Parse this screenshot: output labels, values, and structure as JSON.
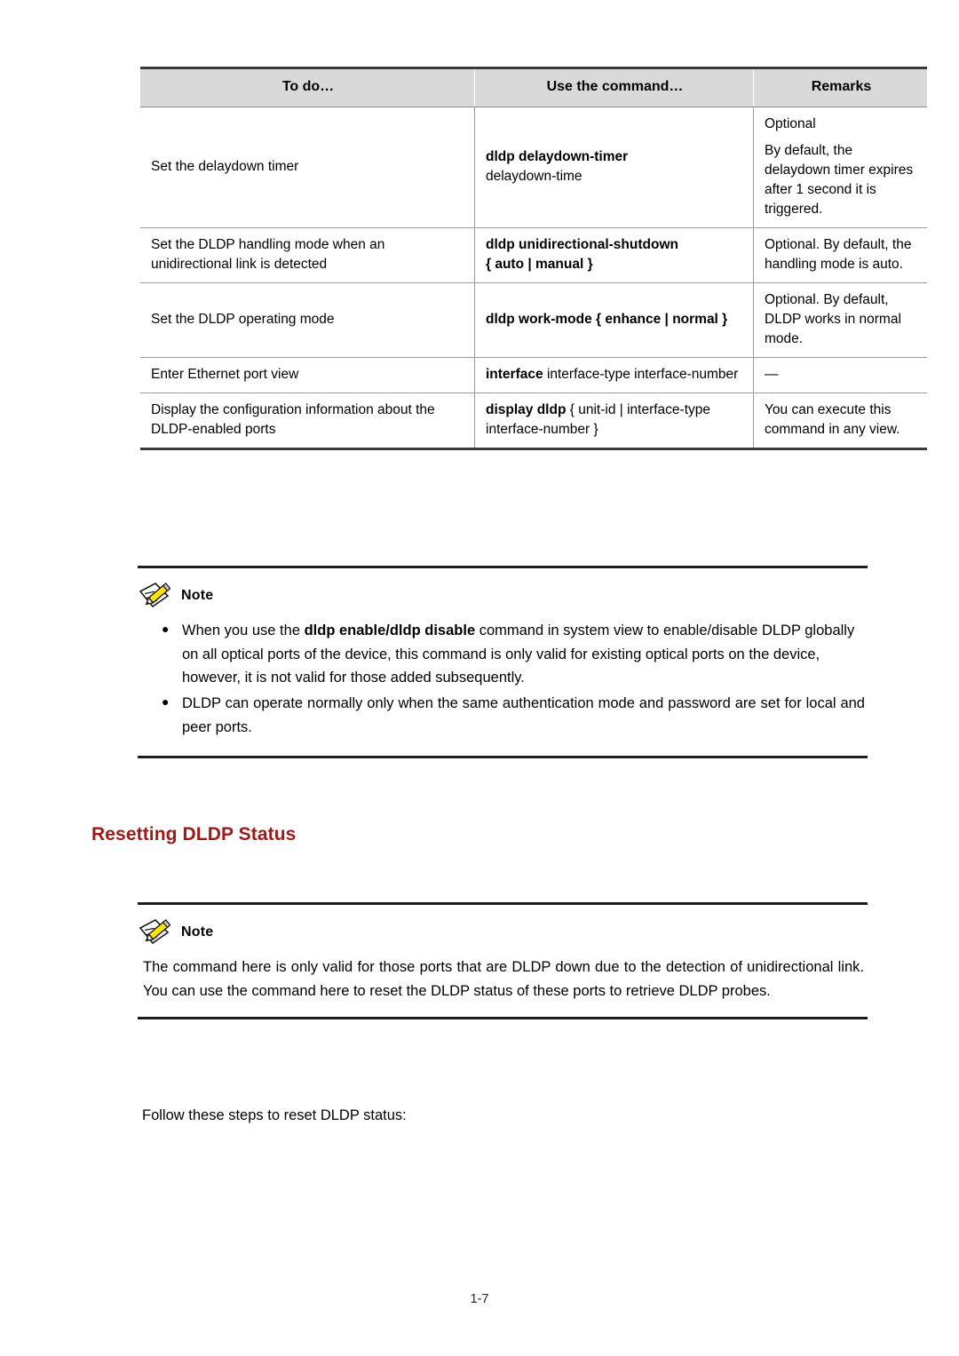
{
  "document": {
    "page_number": "1-7"
  },
  "table": {
    "headers": [
      "To do…",
      "Use the command…",
      "Remarks"
    ],
    "rows": [
      {
        "todo": "Set the delaydown timer",
        "command_bold": "dldp delaydown-timer",
        "command_plain": "delaydown-time",
        "remarks": [
          "Optional",
          "By default, the delaydown timer expires after 1 second it is triggered."
        ]
      },
      {
        "todo": "Set the DLDP handling mode when an unidirectional link is detected",
        "command_bold": "dldp unidirectional-shutdown",
        "command_plain": "{ auto | manual }",
        "remarks": [
          "Optional. By default, the handling mode is auto."
        ]
      },
      {
        "todo": "Set the DLDP operating mode",
        "command_bold": "dldp work-mode",
        "command_plain": "{ enhance | normal }",
        "remarks": [
          "Optional. By default, DLDP works in normal mode."
        ]
      },
      {
        "todo": "Enter Ethernet port view",
        "command_bold": "interface",
        "command_plain": "interface-type interface-number",
        "remarks": [
          "—"
        ]
      },
      {
        "todo": "Display the configuration information about the DLDP-enabled ports",
        "command_bold": "display dldp",
        "command_plain": "{ unit-id | interface-type interface-number }",
        "remarks": [
          "You can execute this command in any view."
        ]
      }
    ]
  },
  "note_top": {
    "title": "Note",
    "icon": "note-pencil-icon",
    "bullets": [
      {
        "prefix": "When you use the ",
        "bold": "dldp enable/dldp disable",
        "suffix": " command in system view to enable/disable DLDP globally on all optical ports of the device, this command is only valid for existing optical ports on the device, however, it is not valid for those added subsequently."
      },
      {
        "prefix": "DLDP can operate normally only when the same authentication mode and password are set for local and peer ports.",
        "bold": "",
        "suffix": ""
      }
    ]
  },
  "heading": {
    "text": "Resetting DLDP Status",
    "color": "#9E1A1A"
  },
  "note_bottom": {
    "title": "Note",
    "icon": "note-pencil-icon",
    "paragraph": "The command here is only valid for those ports that are DLDP down due to the detection of unidirectional link. You can use the command here to reset the DLDP status of these ports to retrieve DLDP probes."
  },
  "body": {
    "intro": "Follow these steps to reset DLDP status:"
  }
}
